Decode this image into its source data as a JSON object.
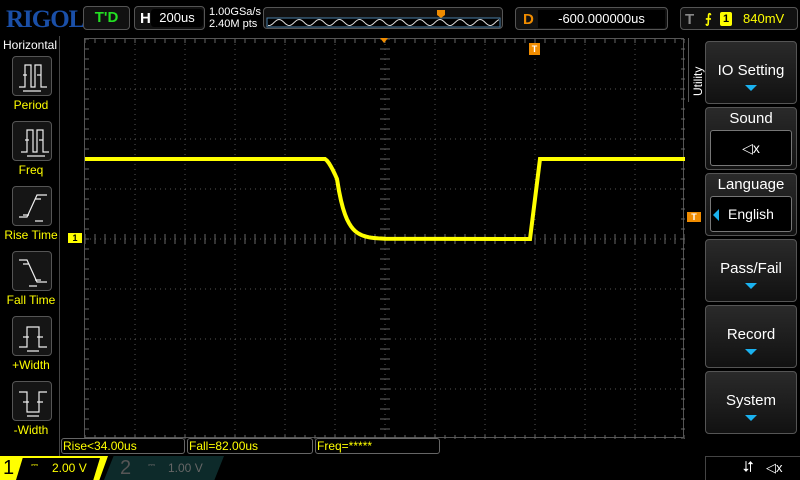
{
  "header": {
    "logo": "RIGOL",
    "run_status": "T'D",
    "horizontal": {
      "key": "H",
      "timebase": "200us"
    },
    "sample_rate": "1.00GSa/s",
    "memory_depth": "2.40M pts",
    "delay": {
      "key": "D",
      "value": "-600.000000us"
    },
    "trigger": {
      "key": "T",
      "slope": "rising-edge-icon",
      "source": "1",
      "level": "840mV"
    }
  },
  "left_panel": {
    "title": "Horizontal",
    "items": [
      {
        "label": "Period",
        "icon": "period-icon"
      },
      {
        "label": "Freq",
        "icon": "freq-icon"
      },
      {
        "label": "Rise Time",
        "icon": "rise-time-icon"
      },
      {
        "label": "Fall Time",
        "icon": "fall-time-icon"
      },
      {
        "label": "+Width",
        "icon": "positive-width-icon"
      },
      {
        "label": "-Width",
        "icon": "negative-width-icon"
      }
    ]
  },
  "right_menu": {
    "title": "Utility",
    "items": [
      {
        "label": "IO Setting"
      },
      {
        "label": "Sound",
        "value_icon": "speaker-muted-icon"
      },
      {
        "label": "Language",
        "value": "English"
      },
      {
        "label": "Pass/Fail"
      },
      {
        "label": "Record"
      },
      {
        "label": "System"
      }
    ]
  },
  "measurements": [
    "Rise<34.00us",
    "Fall=82.00us",
    "Freq=*****"
  ],
  "channels": [
    {
      "num": "1",
      "coupling": "DC",
      "scale": "2.00 V",
      "active": true
    },
    {
      "num": "2",
      "coupling": "DC",
      "scale": "1.00 V",
      "active": false
    }
  ],
  "channel_marker": "1",
  "trigger_marker": "T",
  "colors": {
    "ch1": "#ffff00",
    "trigger": "#f08c00",
    "accent": "#1ab2f0",
    "brand": "#1a4fa8"
  },
  "waveform": {
    "high_div": 1.6,
    "low_div": 0.0,
    "fall_start_div": -1.2,
    "rise_start_div": 2.9
  }
}
